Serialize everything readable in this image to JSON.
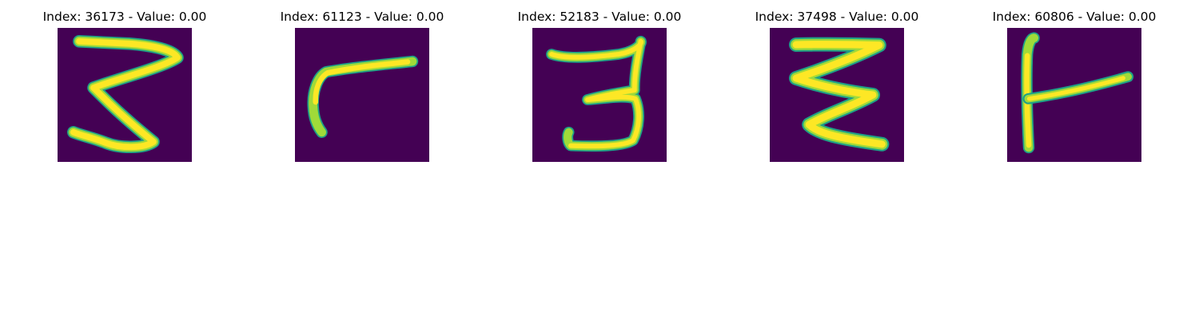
{
  "panels": [
    {
      "title": "Index: 36173 - Value: 0.00",
      "digit_shape": "handwritten-3"
    },
    {
      "title": "Index: 61123 - Value: 0.00",
      "digit_shape": "handwritten-7-like-stroke"
    },
    {
      "title": "Index: 52183 - Value: 0.00",
      "digit_shape": "handwritten-3"
    },
    {
      "title": "Index: 37498 - Value: 0.00",
      "digit_shape": "handwritten-3"
    },
    {
      "title": "Index: 60806 - Value: 0.00",
      "digit_shape": "handwritten-4-like-stroke"
    }
  ],
  "colors": {
    "background": "#440154",
    "stroke_core": "#fde725",
    "stroke_mid": "#a0da39",
    "stroke_edge": "#1fa187"
  }
}
